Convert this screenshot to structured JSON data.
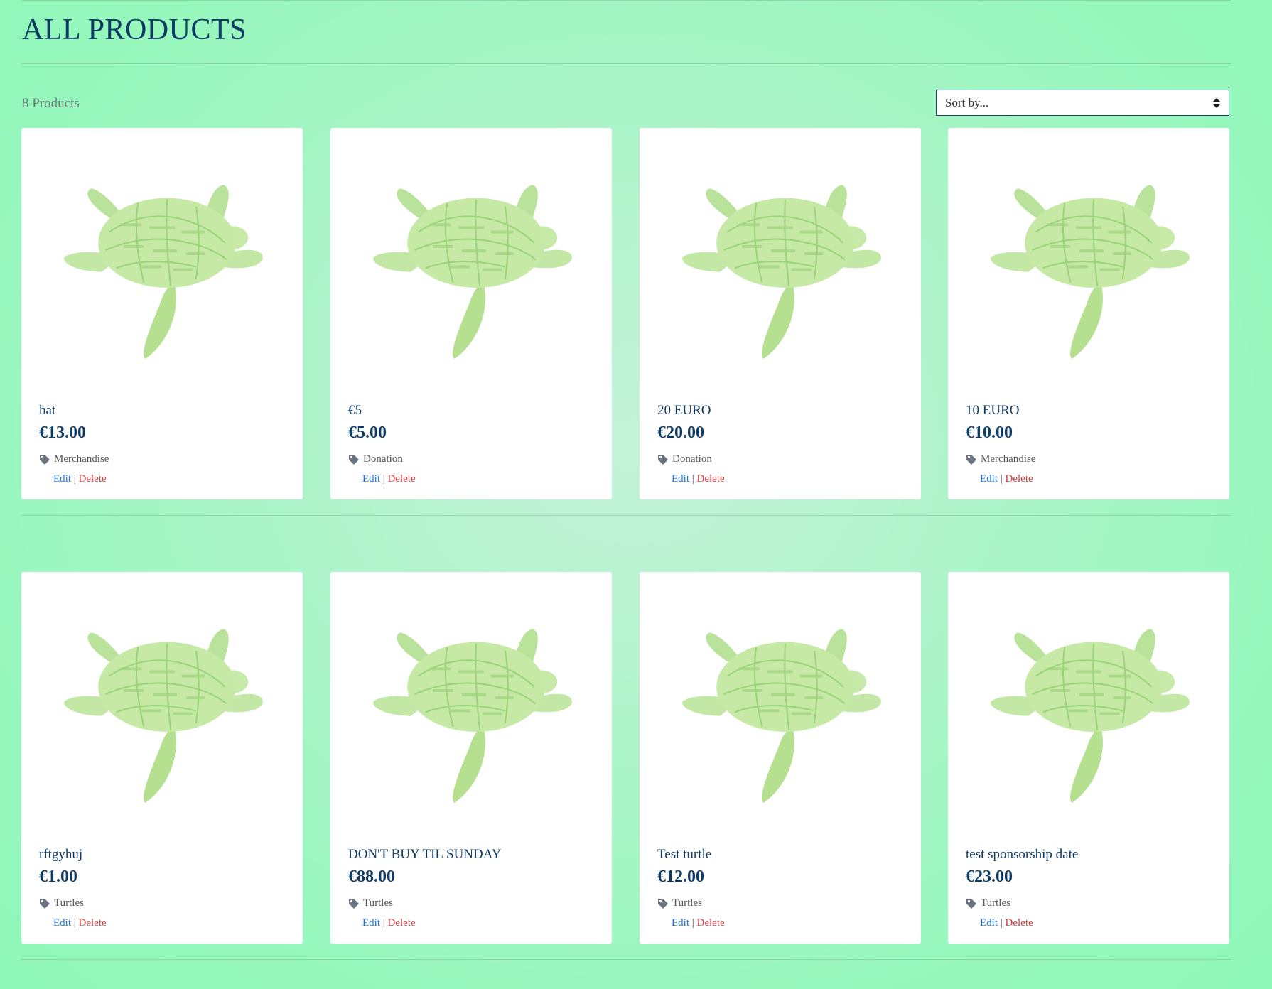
{
  "page": {
    "title": "ALL PRODUCTS",
    "count_label": "8 Products"
  },
  "sort": {
    "label": "Sort by..."
  },
  "colors": {
    "accent": "#0e3a63",
    "edit": "#1a73e8",
    "delete": "#d9383a",
    "card": "#ffffff"
  },
  "products": [
    {
      "name": "hat",
      "price": "€13.00",
      "category": "Merchandise",
      "edit": "Edit",
      "sep": "|",
      "delete": "Delete"
    },
    {
      "name": "€5",
      "price": "€5.00",
      "category": "Donation",
      "edit": "Edit",
      "sep": "|",
      "delete": "Delete"
    },
    {
      "name": "20 EURO",
      "price": "€20.00",
      "category": "Donation",
      "edit": "Edit",
      "sep": "|",
      "delete": "Delete"
    },
    {
      "name": "10 EURO",
      "price": "€10.00",
      "category": "Merchandise",
      "edit": "Edit",
      "sep": "|",
      "delete": "Delete"
    },
    {
      "name": "rftgyhuj",
      "price": "€1.00",
      "category": "Turtles",
      "edit": "Edit",
      "sep": "|",
      "delete": "Delete"
    },
    {
      "name": "DON'T BUY TIL SUNDAY",
      "price": "€88.00",
      "category": "Turtles",
      "edit": "Edit",
      "sep": "|",
      "delete": "Delete"
    },
    {
      "name": "Test turtle",
      "price": "€12.00",
      "category": "Turtles",
      "edit": "Edit",
      "sep": "|",
      "delete": "Delete"
    },
    {
      "name": "test sponsorship date",
      "price": "€23.00",
      "category": "Turtles",
      "edit": "Edit",
      "sep": "|",
      "delete": "Delete"
    }
  ]
}
